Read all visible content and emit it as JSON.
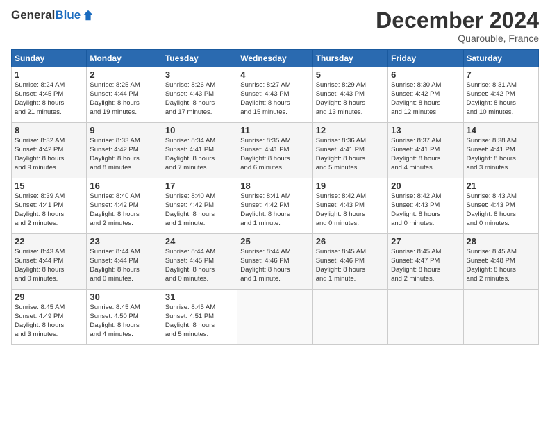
{
  "header": {
    "logo_general": "General",
    "logo_blue": "Blue",
    "month_title": "December 2024",
    "location": "Quarouble, France"
  },
  "columns": [
    "Sunday",
    "Monday",
    "Tuesday",
    "Wednesday",
    "Thursday",
    "Friday",
    "Saturday"
  ],
  "weeks": [
    [
      {
        "day": "1",
        "info": "Sunrise: 8:24 AM\nSunset: 4:45 PM\nDaylight: 8 hours\nand 21 minutes."
      },
      {
        "day": "2",
        "info": "Sunrise: 8:25 AM\nSunset: 4:44 PM\nDaylight: 8 hours\nand 19 minutes."
      },
      {
        "day": "3",
        "info": "Sunrise: 8:26 AM\nSunset: 4:43 PM\nDaylight: 8 hours\nand 17 minutes."
      },
      {
        "day": "4",
        "info": "Sunrise: 8:27 AM\nSunset: 4:43 PM\nDaylight: 8 hours\nand 15 minutes."
      },
      {
        "day": "5",
        "info": "Sunrise: 8:29 AM\nSunset: 4:43 PM\nDaylight: 8 hours\nand 13 minutes."
      },
      {
        "day": "6",
        "info": "Sunrise: 8:30 AM\nSunset: 4:42 PM\nDaylight: 8 hours\nand 12 minutes."
      },
      {
        "day": "7",
        "info": "Sunrise: 8:31 AM\nSunset: 4:42 PM\nDaylight: 8 hours\nand 10 minutes."
      }
    ],
    [
      {
        "day": "8",
        "info": "Sunrise: 8:32 AM\nSunset: 4:42 PM\nDaylight: 8 hours\nand 9 minutes."
      },
      {
        "day": "9",
        "info": "Sunrise: 8:33 AM\nSunset: 4:42 PM\nDaylight: 8 hours\nand 8 minutes."
      },
      {
        "day": "10",
        "info": "Sunrise: 8:34 AM\nSunset: 4:41 PM\nDaylight: 8 hours\nand 7 minutes."
      },
      {
        "day": "11",
        "info": "Sunrise: 8:35 AM\nSunset: 4:41 PM\nDaylight: 8 hours\nand 6 minutes."
      },
      {
        "day": "12",
        "info": "Sunrise: 8:36 AM\nSunset: 4:41 PM\nDaylight: 8 hours\nand 5 minutes."
      },
      {
        "day": "13",
        "info": "Sunrise: 8:37 AM\nSunset: 4:41 PM\nDaylight: 8 hours\nand 4 minutes."
      },
      {
        "day": "14",
        "info": "Sunrise: 8:38 AM\nSunset: 4:41 PM\nDaylight: 8 hours\nand 3 minutes."
      }
    ],
    [
      {
        "day": "15",
        "info": "Sunrise: 8:39 AM\nSunset: 4:41 PM\nDaylight: 8 hours\nand 2 minutes."
      },
      {
        "day": "16",
        "info": "Sunrise: 8:40 AM\nSunset: 4:42 PM\nDaylight: 8 hours\nand 2 minutes."
      },
      {
        "day": "17",
        "info": "Sunrise: 8:40 AM\nSunset: 4:42 PM\nDaylight: 8 hours\nand 1 minute."
      },
      {
        "day": "18",
        "info": "Sunrise: 8:41 AM\nSunset: 4:42 PM\nDaylight: 8 hours\nand 1 minute."
      },
      {
        "day": "19",
        "info": "Sunrise: 8:42 AM\nSunset: 4:43 PM\nDaylight: 8 hours\nand 0 minutes."
      },
      {
        "day": "20",
        "info": "Sunrise: 8:42 AM\nSunset: 4:43 PM\nDaylight: 8 hours\nand 0 minutes."
      },
      {
        "day": "21",
        "info": "Sunrise: 8:43 AM\nSunset: 4:43 PM\nDaylight: 8 hours\nand 0 minutes."
      }
    ],
    [
      {
        "day": "22",
        "info": "Sunrise: 8:43 AM\nSunset: 4:44 PM\nDaylight: 8 hours\nand 0 minutes."
      },
      {
        "day": "23",
        "info": "Sunrise: 8:44 AM\nSunset: 4:44 PM\nDaylight: 8 hours\nand 0 minutes."
      },
      {
        "day": "24",
        "info": "Sunrise: 8:44 AM\nSunset: 4:45 PM\nDaylight: 8 hours\nand 0 minutes."
      },
      {
        "day": "25",
        "info": "Sunrise: 8:44 AM\nSunset: 4:46 PM\nDaylight: 8 hours\nand 1 minute."
      },
      {
        "day": "26",
        "info": "Sunrise: 8:45 AM\nSunset: 4:46 PM\nDaylight: 8 hours\nand 1 minute."
      },
      {
        "day": "27",
        "info": "Sunrise: 8:45 AM\nSunset: 4:47 PM\nDaylight: 8 hours\nand 2 minutes."
      },
      {
        "day": "28",
        "info": "Sunrise: 8:45 AM\nSunset: 4:48 PM\nDaylight: 8 hours\nand 2 minutes."
      }
    ],
    [
      {
        "day": "29",
        "info": "Sunrise: 8:45 AM\nSunset: 4:49 PM\nDaylight: 8 hours\nand 3 minutes."
      },
      {
        "day": "30",
        "info": "Sunrise: 8:45 AM\nSunset: 4:50 PM\nDaylight: 8 hours\nand 4 minutes."
      },
      {
        "day": "31",
        "info": "Sunrise: 8:45 AM\nSunset: 4:51 PM\nDaylight: 8 hours\nand 5 minutes."
      },
      {
        "day": "",
        "info": ""
      },
      {
        "day": "",
        "info": ""
      },
      {
        "day": "",
        "info": ""
      },
      {
        "day": "",
        "info": ""
      }
    ]
  ]
}
